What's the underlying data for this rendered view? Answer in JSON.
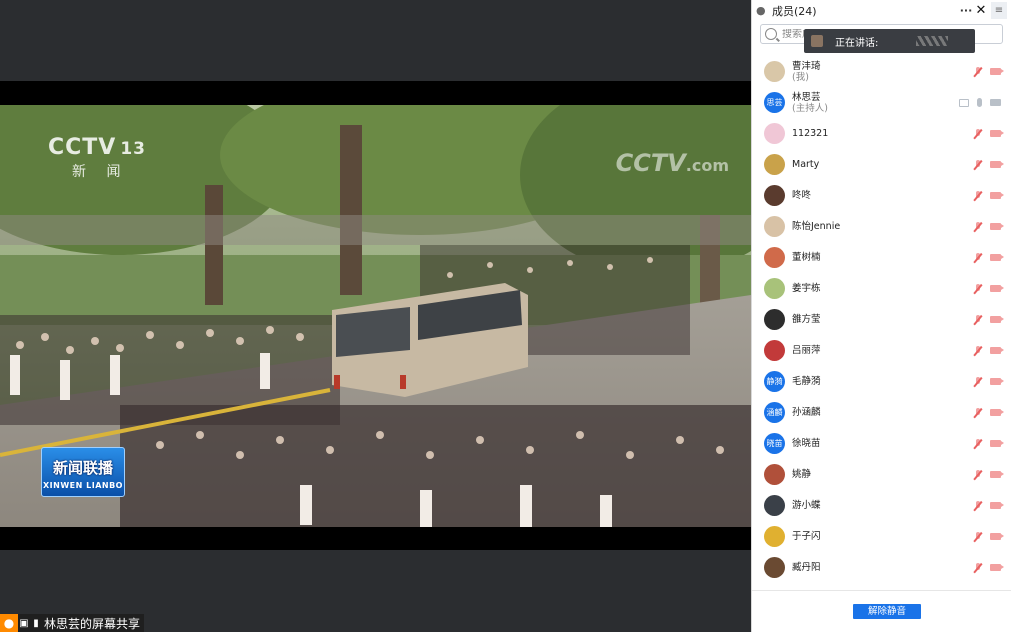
{
  "video": {
    "channel_logo": "CCTV",
    "channel_number": "13",
    "channel_sub": "新 闻",
    "watermark": "CCTV",
    "watermark_suffix": ".com",
    "badge_cn": "新闻联播",
    "badge_en": "XINWEN LIANBO"
  },
  "share_bar": {
    "text": "林思芸的屏幕共享"
  },
  "panel": {
    "title": "成员(24)",
    "more_label": "···",
    "close_label": "✕",
    "menu_label": "≡",
    "search_placeholder": "搜索成员",
    "speaking_label": "正在讲话:",
    "unmute_all_label": "解除静音"
  },
  "members": [
    {
      "name": "曹沣琦",
      "role": "(我)",
      "avatar": "photo",
      "color": "#d9c7a8",
      "status": "muted"
    },
    {
      "name": "林思芸",
      "role": "(主持人)",
      "avatar": "text",
      "avatar_text": "思芸",
      "status": "host"
    },
    {
      "name": "112321",
      "role": "",
      "avatar": "photo",
      "color": "#f0c7d6",
      "status": "muted"
    },
    {
      "name": "Marty",
      "role": "",
      "avatar": "photo",
      "color": "#c9a24a",
      "status": "muted"
    },
    {
      "name": "咚咚",
      "role": "",
      "avatar": "photo",
      "color": "#5a3b2e",
      "status": "muted"
    },
    {
      "name": "陈怡Jennie",
      "role": "",
      "avatar": "photo",
      "color": "#d8c2a6",
      "status": "muted"
    },
    {
      "name": "董树楠",
      "role": "",
      "avatar": "photo",
      "color": "#d06a4a",
      "status": "muted"
    },
    {
      "name": "姜宇栋",
      "role": "",
      "avatar": "photo",
      "color": "#a8c27a",
      "status": "muted"
    },
    {
      "name": "雒方莹",
      "role": "",
      "avatar": "photo",
      "color": "#2d2d2d",
      "status": "muted"
    },
    {
      "name": "吕丽萍",
      "role": "",
      "avatar": "photo",
      "color": "#c23a3a",
      "status": "muted"
    },
    {
      "name": "毛静漪",
      "role": "",
      "avatar": "text",
      "avatar_text": "静漪",
      "status": "muted"
    },
    {
      "name": "孙涵麟",
      "role": "",
      "avatar": "text",
      "avatar_text": "涵麟",
      "status": "muted"
    },
    {
      "name": "徐晓苗",
      "role": "",
      "avatar": "text",
      "avatar_text": "晓苗",
      "status": "muted"
    },
    {
      "name": "姚静",
      "role": "",
      "avatar": "photo",
      "color": "#b0503a",
      "status": "muted"
    },
    {
      "name": "游小蝶",
      "role": "",
      "avatar": "photo",
      "color": "#3a4048",
      "status": "muted"
    },
    {
      "name": "于子闪",
      "role": "",
      "avatar": "photo",
      "color": "#e0b030",
      "status": "muted"
    },
    {
      "name": "臧丹阳",
      "role": "",
      "avatar": "photo",
      "color": "#6a4a32",
      "status": "muted"
    }
  ]
}
